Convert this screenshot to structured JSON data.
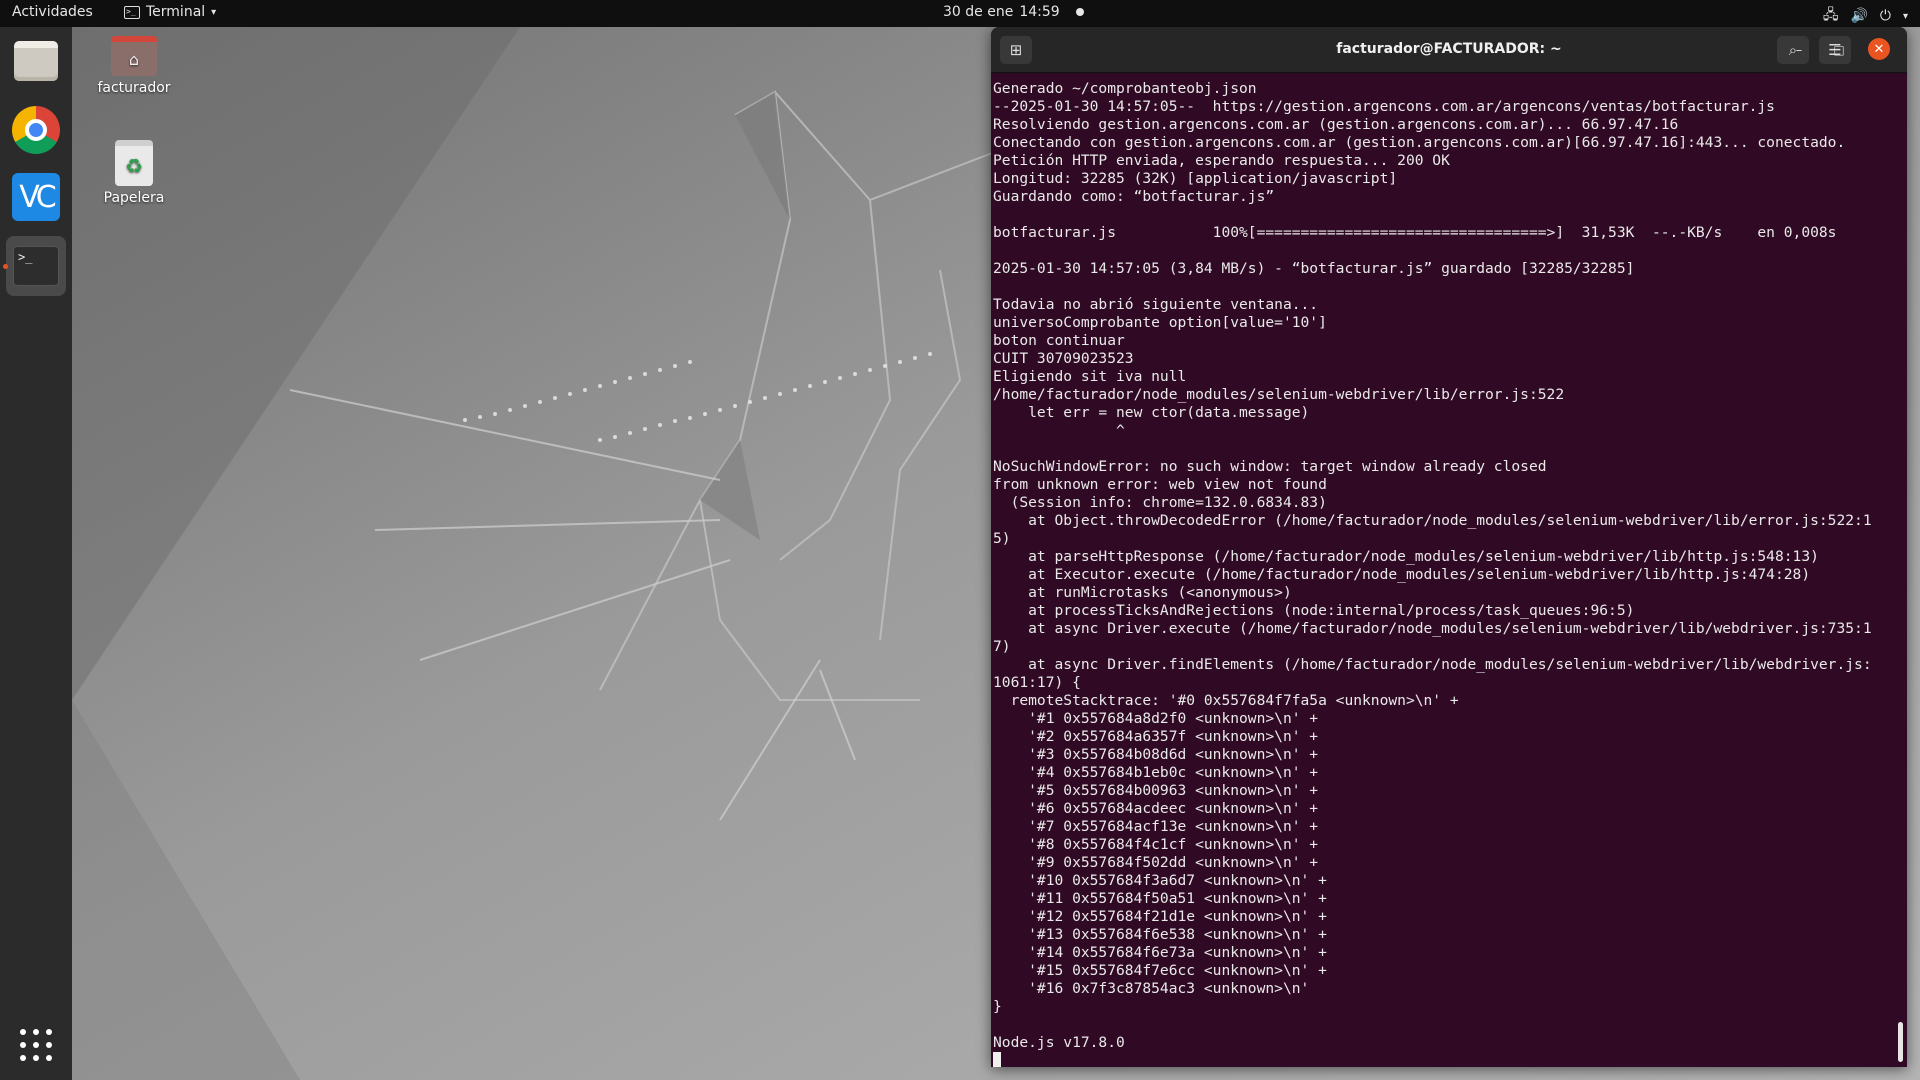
{
  "topbar": {
    "activities": "Actividades",
    "app_name": "Terminal",
    "date": "30 de ene",
    "time": "14:59"
  },
  "dock": {
    "items": [
      "files-icon",
      "chrome-icon",
      "vscode-icon",
      "terminal-icon",
      "apps-grid-icon"
    ],
    "vscode_label": "VC"
  },
  "desktop": {
    "home_label": "facturador",
    "trash_label": "Papelera"
  },
  "terminal": {
    "title": "facturador@FACTURADOR: ~",
    "lines": [
      "Generado ~/comprobanteobj.json",
      "--2025-01-30 14:57:05--  https://gestion.argencons.com.ar/argencons/ventas/botfacturar.js",
      "Resolviendo gestion.argencons.com.ar (gestion.argencons.com.ar)... 66.97.47.16",
      "Conectando con gestion.argencons.com.ar (gestion.argencons.com.ar)[66.97.47.16]:443... conectado.",
      "Petición HTTP enviada, esperando respuesta... 200 OK",
      "Longitud: 32285 (32K) [application/javascript]",
      "Guardando como: “botfacturar.js”",
      "",
      "botfacturar.js           100%[=================================>]  31,53K  --.-KB/s    en 0,008s",
      "",
      "2025-01-30 14:57:05 (3,84 MB/s) - “botfacturar.js” guardado [32285/32285]",
      "",
      "Todavia no abrió siguiente ventana...",
      "universoComprobante option[value='10']",
      "boton continuar",
      "CUIT 30709023523",
      "Eligiendo sit iva null",
      "/home/facturador/node_modules/selenium-webdriver/lib/error.js:522",
      "    let err = new ctor(data.message)",
      "              ^",
      "",
      "NoSuchWindowError: no such window: target window already closed",
      "from unknown error: web view not found",
      "  (Session info: chrome=132.0.6834.83)",
      "    at Object.throwDecodedError (/home/facturador/node_modules/selenium-webdriver/lib/error.js:522:1",
      "5)",
      "    at parseHttpResponse (/home/facturador/node_modules/selenium-webdriver/lib/http.js:548:13)",
      "    at Executor.execute (/home/facturador/node_modules/selenium-webdriver/lib/http.js:474:28)",
      "    at runMicrotasks (<anonymous>)",
      "    at processTicksAndRejections (node:internal/process/task_queues:96:5)",
      "    at async Driver.execute (/home/facturador/node_modules/selenium-webdriver/lib/webdriver.js:735:1",
      "7)",
      "    at async Driver.findElements (/home/facturador/node_modules/selenium-webdriver/lib/webdriver.js:",
      "1061:17) {",
      "  remoteStacktrace: '#0 0x557684f7fa5a <unknown>\\n' +",
      "    '#1 0x557684a8d2f0 <unknown>\\n' +",
      "    '#2 0x557684a6357f <unknown>\\n' +",
      "    '#3 0x557684b08d6d <unknown>\\n' +",
      "    '#4 0x557684b1eb0c <unknown>\\n' +",
      "    '#5 0x557684b00963 <unknown>\\n' +",
      "    '#6 0x557684acdeec <unknown>\\n' +",
      "    '#7 0x557684acf13e <unknown>\\n' +",
      "    '#8 0x557684f4c1cf <unknown>\\n' +",
      "    '#9 0x557684f502dd <unknown>\\n' +",
      "    '#10 0x557684f3a6d7 <unknown>\\n' +",
      "    '#11 0x557684f50a51 <unknown>\\n' +",
      "    '#12 0x557684f21d1e <unknown>\\n' +",
      "    '#13 0x557684f6e538 <unknown>\\n' +",
      "    '#14 0x557684f6e73a <unknown>\\n' +",
      "    '#15 0x557684f7e6cc <unknown>\\n' +",
      "    '#16 0x7f3c87854ac3 <unknown>\\n'",
      "}",
      "",
      "Node.js v17.8.0"
    ]
  },
  "colors": {
    "terminal_bg": "#300a24",
    "accent": "#e95420",
    "topbar_bg": "#0f0f0f",
    "dock_bg": "#2b2b2b"
  }
}
